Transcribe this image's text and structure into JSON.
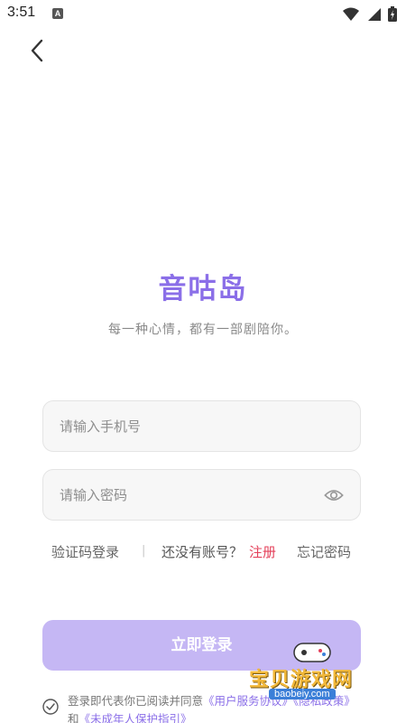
{
  "status_bar": {
    "time": "3:51",
    "indicator": "A"
  },
  "app": {
    "title": "音咕岛",
    "slogan": "每一种心情，都有一部剧陪你。",
    "accent_color": "#8b6fe8"
  },
  "form": {
    "phone_placeholder": "请输入手机号",
    "password_placeholder": "请输入密码"
  },
  "links": {
    "sms_login": "验证码登录",
    "divider": "|",
    "no_account": "还没有账号？",
    "register": "注册",
    "forgot_password": "忘记密码"
  },
  "login_button": "立即登录",
  "agreement": {
    "prefix": "登录即代表你已阅读并同意",
    "user_agreement": "《用户服务协议》",
    "privacy_policy_tail": "《隐私政策》",
    "and": "和",
    "minor_guide": "《未成年人保护指引》"
  },
  "watermark": {
    "text": "宝贝游戏网",
    "url": "baobeiy.com"
  },
  "icons": [
    "back-arrow-icon",
    "eye-icon",
    "check-circle-icon",
    "wifi-icon",
    "signal-icon",
    "battery-icon"
  ]
}
